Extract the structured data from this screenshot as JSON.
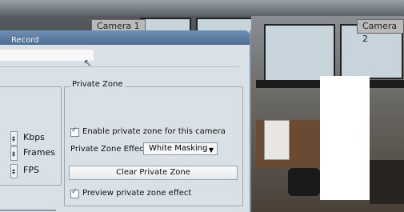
{
  "cameras": [
    {
      "label": "Camera 1"
    },
    {
      "label": "Camera 2"
    }
  ],
  "dialog": {
    "title": "Record",
    "units": {
      "bitrate": "Kbps",
      "frames": "Frames",
      "fps": "FPS"
    },
    "private_zone": {
      "group_title": "Private Zone",
      "enable_label": "Enable private zone for this camera",
      "enable_checked": true,
      "effect_label": "Private Zone Effect",
      "effect_value": "White Masking",
      "clear_button": "Clear Private Zone",
      "preview_label": "Preview private zone effect",
      "preview_checked": true
    }
  },
  "colors": {
    "titlebar": "#5a7aa3",
    "dialog_bg": "#d9e1e6",
    "mask": "#ffffff"
  }
}
